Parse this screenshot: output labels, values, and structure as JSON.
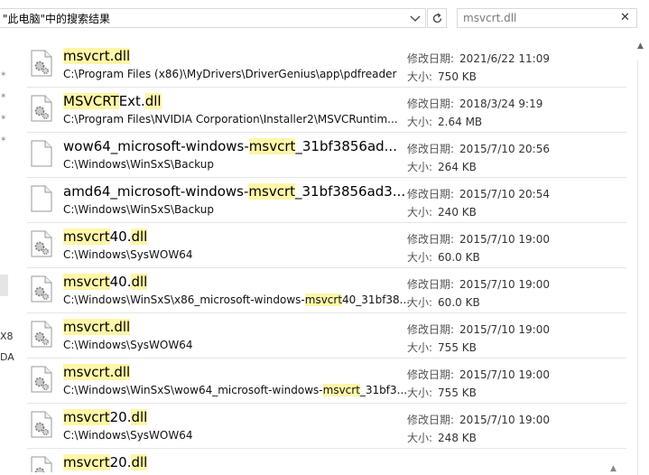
{
  "address_bar": {
    "text": "\"此电脑\"中的搜索结果"
  },
  "search": {
    "value": "msvcrt.dll",
    "close": "✕"
  },
  "meta_labels": {
    "date": "修改日期:",
    "size": "大小:"
  },
  "left_pane": {
    "frag1": "X8",
    "frag2": "DA"
  },
  "results": [
    {
      "icon": "dll-file-icon",
      "name_parts": [
        {
          "t": "msvcrt.dll",
          "hl": true
        }
      ],
      "path_parts": [
        {
          "t": "C:\\Program Files (x86)\\MyDrivers\\DriverGenius\\app\\pdfreader",
          "hl": false
        }
      ],
      "date": "2021/6/22 11:09",
      "size": "750 KB"
    },
    {
      "icon": "dll-file-icon",
      "name_parts": [
        {
          "t": "MSVCRT",
          "hl": true
        },
        {
          "t": "Ext.",
          "hl": false
        },
        {
          "t": "dll",
          "hl": true
        }
      ],
      "path_parts": [
        {
          "t": "C:\\Program Files\\NVIDIA Corporation\\Installer2\\MSVCRuntim...",
          "hl": false
        }
      ],
      "date": "2018/3/24 9:19",
      "size": "2.64 MB"
    },
    {
      "icon": "blank-file-icon",
      "name_parts": [
        {
          "t": "wow64_microsoft-windows-",
          "hl": false
        },
        {
          "t": "msvcrt",
          "hl": true
        },
        {
          "t": "_31bf3856ad...",
          "hl": false
        }
      ],
      "path_parts": [
        {
          "t": "C:\\Windows\\WinSxS\\Backup",
          "hl": false
        }
      ],
      "date": "2015/7/10 20:56",
      "size": "264 KB"
    },
    {
      "icon": "blank-file-icon",
      "name_parts": [
        {
          "t": "amd64_microsoft-windows-",
          "hl": false
        },
        {
          "t": "msvcrt",
          "hl": true
        },
        {
          "t": "_31bf3856ad3...",
          "hl": false
        }
      ],
      "path_parts": [
        {
          "t": "C:\\Windows\\WinSxS\\Backup",
          "hl": false
        }
      ],
      "date": "2015/7/10 20:54",
      "size": "240 KB"
    },
    {
      "icon": "dll-file-icon",
      "name_parts": [
        {
          "t": "msvcrt",
          "hl": true
        },
        {
          "t": "40.",
          "hl": false
        },
        {
          "t": "dll",
          "hl": true
        }
      ],
      "path_parts": [
        {
          "t": "C:\\Windows\\SysWOW64",
          "hl": false
        }
      ],
      "date": "2015/7/10 19:00",
      "size": "60.0 KB"
    },
    {
      "icon": "dll-file-icon",
      "name_parts": [
        {
          "t": "msvcrt",
          "hl": true
        },
        {
          "t": "40.",
          "hl": false
        },
        {
          "t": "dll",
          "hl": true
        }
      ],
      "path_parts": [
        {
          "t": "C:\\Windows\\WinSxS\\x86_microsoft-windows-",
          "hl": false
        },
        {
          "t": "msvcrt",
          "hl": true
        },
        {
          "t": "40_31bf38...",
          "hl": false
        }
      ],
      "date": "2015/7/10 19:00",
      "size": "60.0 KB"
    },
    {
      "icon": "dll-file-icon",
      "name_parts": [
        {
          "t": "msvcrt.dll",
          "hl": true
        }
      ],
      "path_parts": [
        {
          "t": "C:\\Windows\\SysWOW64",
          "hl": false
        }
      ],
      "date": "2015/7/10 19:00",
      "size": "755 KB"
    },
    {
      "icon": "dll-file-icon",
      "name_parts": [
        {
          "t": "msvcrt.dll",
          "hl": true
        }
      ],
      "path_parts": [
        {
          "t": "C:\\Windows\\WinSxS\\wow64_microsoft-windows-",
          "hl": false
        },
        {
          "t": "msvcrt",
          "hl": true
        },
        {
          "t": "_31bf3...",
          "hl": false
        }
      ],
      "date": "2015/7/10 19:00",
      "size": "755 KB"
    },
    {
      "icon": "dll-file-icon",
      "name_parts": [
        {
          "t": "msvcrt",
          "hl": true
        },
        {
          "t": "20.",
          "hl": false
        },
        {
          "t": "dll",
          "hl": true
        }
      ],
      "path_parts": [
        {
          "t": "C:\\Windows\\SysWOW64",
          "hl": false
        }
      ],
      "date": "2015/7/10 19:00",
      "size": "248 KB"
    },
    {
      "icon": "dll-file-icon",
      "name_parts": [
        {
          "t": "msvcrt",
          "hl": true
        },
        {
          "t": "20.",
          "hl": false
        },
        {
          "t": "dll",
          "hl": true
        }
      ],
      "path_parts": [],
      "date": "",
      "size": ""
    }
  ],
  "colors": {
    "highlight": "#fff6a8",
    "divider": "#e6e6e6"
  }
}
